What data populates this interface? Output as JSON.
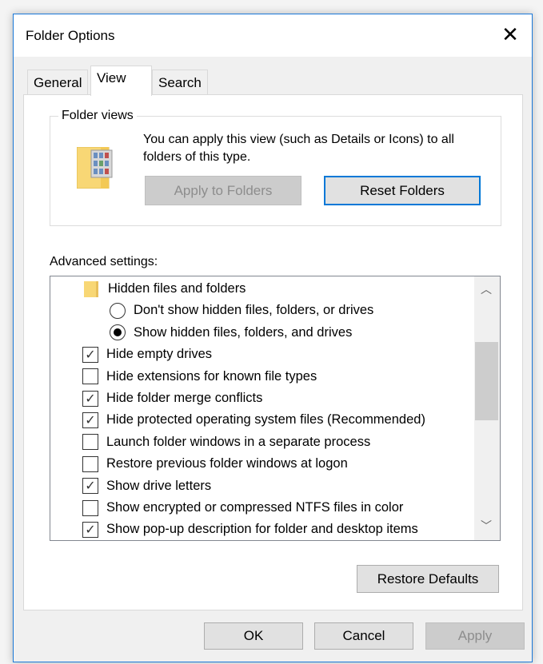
{
  "window": {
    "title": "Folder Options",
    "close_icon": "close-icon"
  },
  "tabs": [
    {
      "label": "General"
    },
    {
      "label": "View",
      "active": true
    },
    {
      "label": "Search"
    }
  ],
  "folder_views": {
    "label": "Folder views",
    "description": "You can apply this view (such as Details or Icons) to all folders of this type.",
    "apply_button": "Apply to Folders",
    "reset_button": "Reset Folders"
  },
  "advanced": {
    "label": "Advanced settings:",
    "items": [
      {
        "type": "folder",
        "label": "Hidden files and folders"
      },
      {
        "type": "radio",
        "label": "Don't show hidden files, folders, or drives",
        "checked": false
      },
      {
        "type": "radio",
        "label": "Show hidden files, folders, and drives",
        "checked": true
      },
      {
        "type": "checkbox",
        "label": "Hide empty drives",
        "checked": true
      },
      {
        "type": "checkbox",
        "label": "Hide extensions for known file types",
        "checked": false
      },
      {
        "type": "checkbox",
        "label": "Hide folder merge conflicts",
        "checked": true
      },
      {
        "type": "checkbox",
        "label": "Hide protected operating system files (Recommended)",
        "checked": true
      },
      {
        "type": "checkbox",
        "label": "Launch folder windows in a separate process",
        "checked": false
      },
      {
        "type": "checkbox",
        "label": "Restore previous folder windows at logon",
        "checked": false
      },
      {
        "type": "checkbox",
        "label": "Show drive letters",
        "checked": true
      },
      {
        "type": "checkbox",
        "label": "Show encrypted or compressed NTFS files in color",
        "checked": false
      },
      {
        "type": "checkbox",
        "label": "Show pop-up description for folder and desktop items",
        "checked": true
      }
    ],
    "restore_button": "Restore Defaults"
  },
  "footer": {
    "ok": "OK",
    "cancel": "Cancel",
    "apply": "Apply"
  },
  "colors": {
    "accent": "#0078d7",
    "folder": "#f8d775"
  }
}
